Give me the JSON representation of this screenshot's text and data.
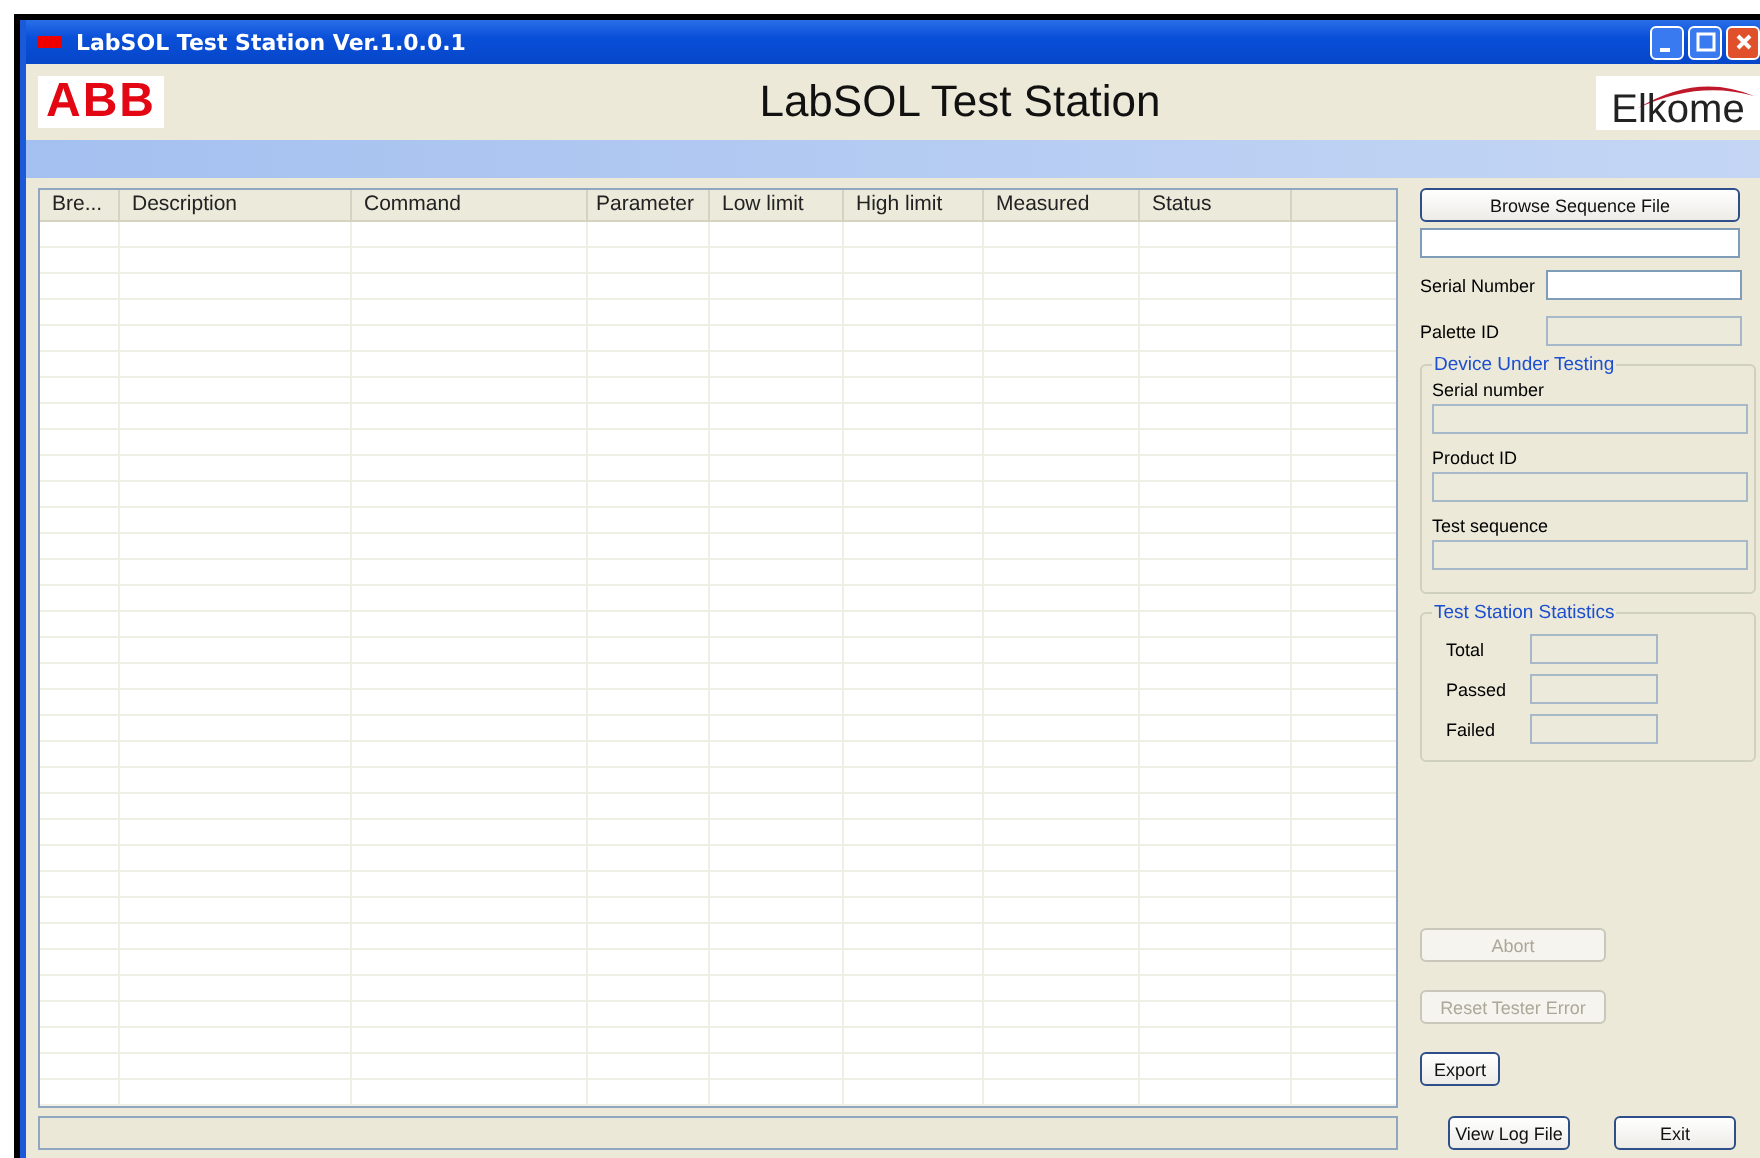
{
  "window": {
    "title": "LabSOL Test Station Ver.1.0.0.1"
  },
  "header": {
    "left_logo": "ABB",
    "title": "LabSOL Test Station",
    "right_logo": "Elkome"
  },
  "table": {
    "columns": [
      "Bre...",
      "Description",
      "Command",
      "Parameter",
      "Low limit",
      "High limit",
      "Measured",
      "Status"
    ]
  },
  "side": {
    "browse_button": {
      "label": "Browse Sequence File",
      "disabled": false
    },
    "file_field": {
      "disabled": false
    },
    "fields": [
      {
        "label": "Serial Number",
        "disabled": false
      },
      {
        "label": "Palette ID",
        "disabled": true
      }
    ],
    "dut": {
      "title": "Device Under Testing",
      "fields": [
        {
          "label": "Serial number",
          "disabled": true
        },
        {
          "label": "Product ID",
          "disabled": true
        },
        {
          "label": "Test sequence",
          "disabled": true
        }
      ]
    },
    "stats": {
      "title": "Test Station Statistics",
      "fields": [
        {
          "label": "Total",
          "disabled": true
        },
        {
          "label": "Passed",
          "disabled": true
        },
        {
          "label": "Failed",
          "disabled": true
        }
      ]
    },
    "buttons": [
      {
        "label": "Abort",
        "disabled": true
      },
      {
        "label": "Reset Tester Error",
        "disabled": true
      },
      {
        "label": "Export",
        "disabled": false
      }
    ],
    "bottom_buttons": [
      {
        "label": "View Log File",
        "disabled": false
      },
      {
        "label": "Exit",
        "disabled": false
      }
    ]
  }
}
